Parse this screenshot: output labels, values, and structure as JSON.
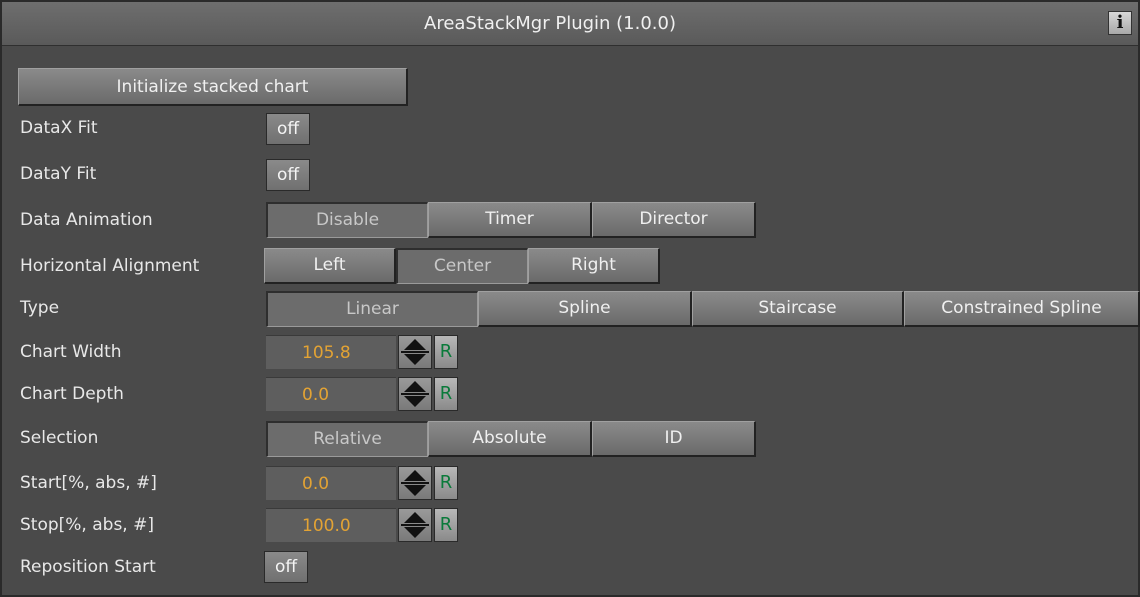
{
  "panel": {
    "title": "AreaStackMgr Plugin (1.0.0)",
    "info_icon": "i"
  },
  "init_button": "Initialize stacked chart",
  "rows": {
    "datax_fit": {
      "label": "DataX Fit",
      "value": "off"
    },
    "datay_fit": {
      "label": "DataY Fit",
      "value": "off"
    },
    "data_animation": {
      "label": "Data Animation",
      "options": [
        "Disable",
        "Timer",
        "Director"
      ],
      "selected": "Disable"
    },
    "horizontal_alignment": {
      "label": "Horizontal Alignment",
      "options": [
        "Left",
        "Center",
        "Right"
      ],
      "selected": "Center"
    },
    "type": {
      "label": "Type",
      "options": [
        "Linear",
        "Spline",
        "Staircase",
        "Constrained Spline"
      ],
      "selected": "Linear"
    },
    "chart_width": {
      "label": "Chart Width",
      "value": "105.8",
      "reset": "R"
    },
    "chart_depth": {
      "label": "Chart Depth",
      "value": "0.0",
      "reset": "R"
    },
    "selection": {
      "label": "Selection",
      "options": [
        "Relative",
        "Absolute",
        "ID"
      ],
      "selected": "Relative"
    },
    "start": {
      "label": "Start[%, abs, #]",
      "value": "0.0",
      "reset": "R"
    },
    "stop": {
      "label": "Stop[%, abs, #]",
      "value": "100.0",
      "reset": "R"
    },
    "reposition_start": {
      "label": "Reposition Start",
      "value": "off"
    }
  },
  "colors": {
    "panel_bg": "#4a4a4a",
    "value_text": "#e3a334",
    "reset_text": "#0a7a3a"
  }
}
